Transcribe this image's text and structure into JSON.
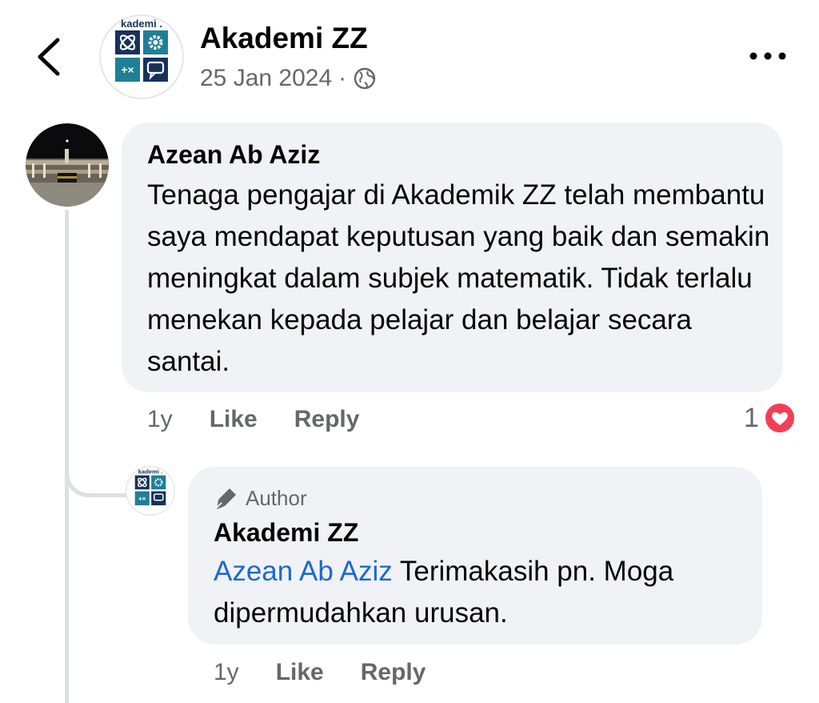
{
  "header": {
    "page_name": "Akademi ZZ",
    "date": "25 Jan 2024",
    "separator": "·",
    "privacy_icon": "globe-icon",
    "back_icon": "chevron-left-icon",
    "more_icon": "more-dots-icon",
    "logo_text": "kademi ."
  },
  "comment": {
    "author": "Azean Ab Aziz",
    "text": "Tenaga pengajar di Akademik ZZ telah membantu saya mendapat keputusan yang baik dan semakin meningkat dalam subjek matematik. Tidak terlalu menekan kepada pelajar dan belajar secara santai.",
    "time": "1y",
    "like_label": "Like",
    "reply_label": "Reply",
    "reaction_count": "1",
    "reaction_icon": "heart-reaction-icon"
  },
  "reply": {
    "badge_label": "Author",
    "badge_icon": "pen-icon",
    "author": "Akademi ZZ",
    "mention": "Azean Ab Aziz",
    "text": " Terimakasih pn. Moga dipermudahkan urusan.",
    "time": "1y",
    "like_label": "Like",
    "reply_label": "Reply"
  },
  "colors": {
    "bubble_bg": "#f0f2f5",
    "secondary_text": "#65676b",
    "mention_blue": "#1b6ad0",
    "heart_red": "#f33e58",
    "logo_teal": "#1f7f97",
    "logo_navy": "#17325a"
  }
}
